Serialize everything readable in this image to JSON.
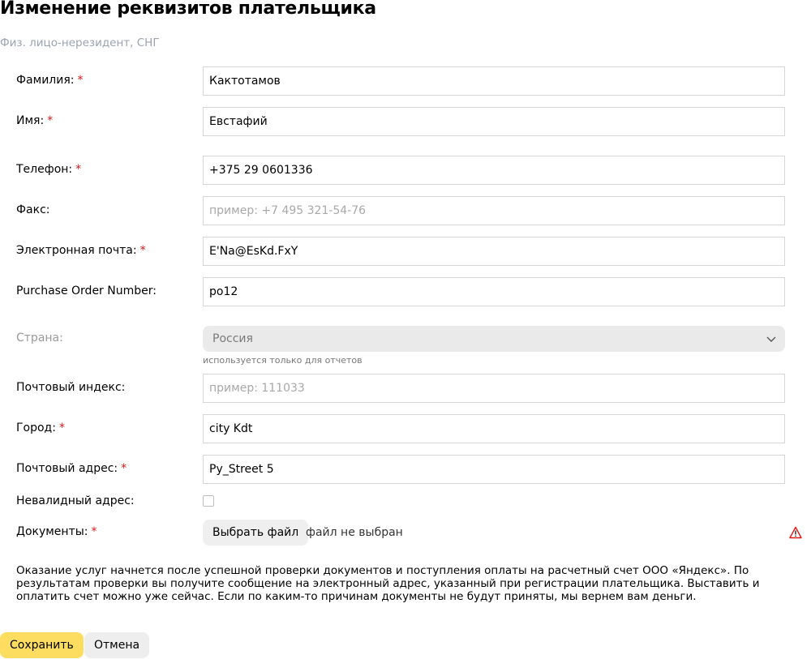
{
  "page": {
    "title": "Изменение реквизитов плательщика",
    "subtitle": "Физ. лицо-нерезидент, СНГ"
  },
  "form": {
    "surname": {
      "label": "Фамилия:",
      "required": "*",
      "value": "Кактотамов"
    },
    "name": {
      "label": "Имя:",
      "required": "*",
      "value": "Евстафий"
    },
    "phone": {
      "label": "Телефон:",
      "required": "*",
      "value": "+375 29 0601336"
    },
    "fax": {
      "label": "Факс:",
      "value": "",
      "placeholder": "пример: +7 495 321-54-76"
    },
    "email": {
      "label": "Электронная почта:",
      "required": "*",
      "value": "E'Na@EsKd.FxY"
    },
    "po_number": {
      "label": "Purchase Order Number:",
      "value": "po12"
    },
    "country": {
      "label": "Страна:",
      "value": "Россия",
      "hint": "используется только для отчетов"
    },
    "postcode": {
      "label": "Почтовый индекс:",
      "value": "",
      "placeholder": "пример: 111033"
    },
    "city": {
      "label": "Город:",
      "required": "*",
      "value": "city Kdt"
    },
    "address": {
      "label": "Почтовый адрес:",
      "required": "*",
      "value": "Py_Street 5"
    },
    "invalid_address": {
      "label": "Невалидный адрес:",
      "checked": false
    },
    "documents": {
      "label": "Документы:",
      "required": "*",
      "button_label": "Выбрать файл",
      "status": "файл не выбран",
      "warning_icon": "warning-triangle-icon"
    }
  },
  "info_text": "Оказание услуг начнется после успешной проверки документов и поступления оплаты на расчетный счет ООО «Яндекс». По результатам проверки вы получите сообщение на электронный адрес, указанный при регистрации плательщика. Выставить и оплатить счет можно уже сейчас. Если по каким-то причинам документы не будут приняты, мы вернем вам деньги.",
  "actions": {
    "save_label": "Сохранить",
    "cancel_label": "Отмена"
  },
  "colors": {
    "accent": "#fddd60",
    "required": "#e01616",
    "warning": "#e01616",
    "subtitle": "#9aa3b0"
  }
}
